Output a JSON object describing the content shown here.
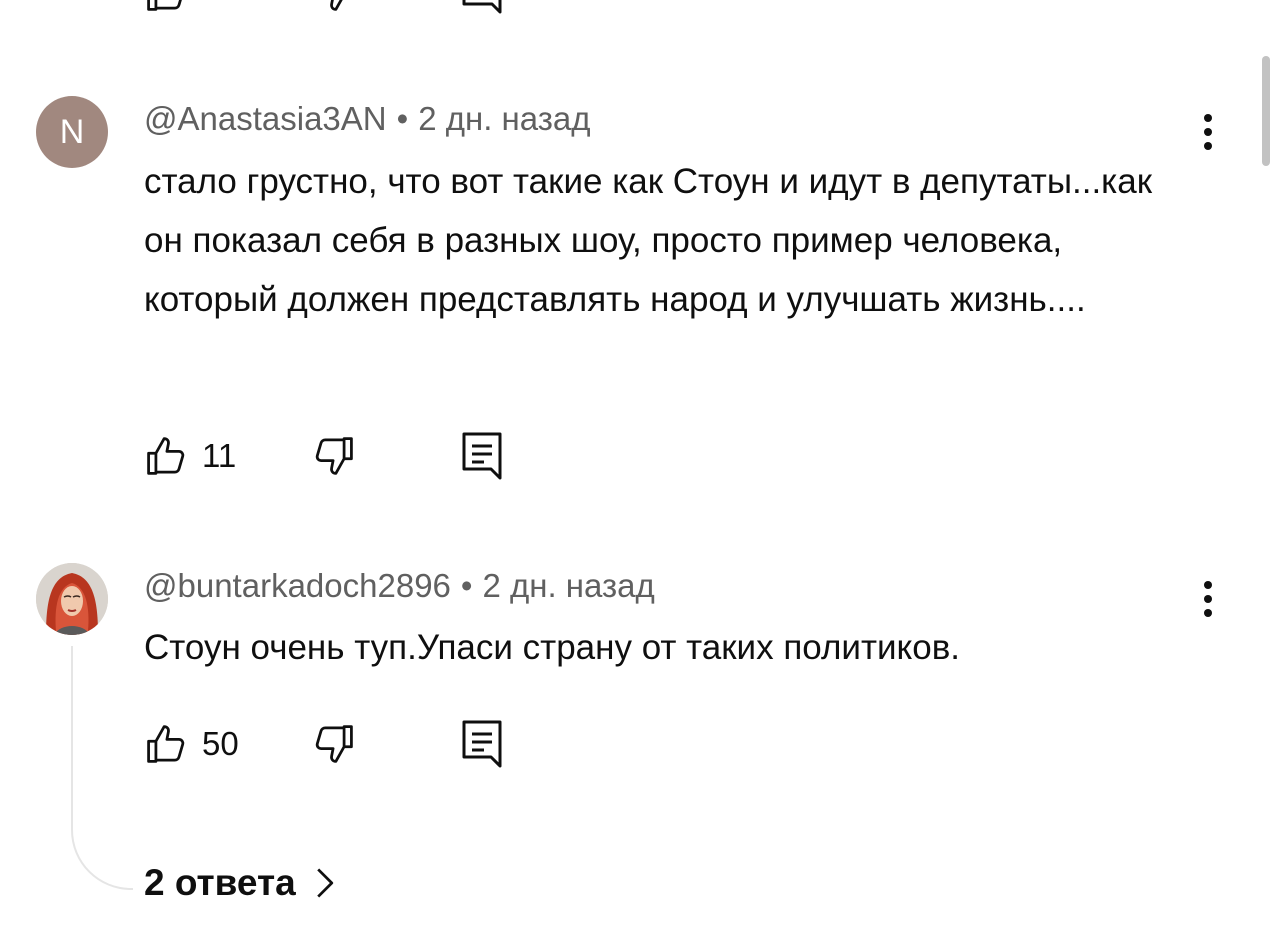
{
  "comments": [
    {
      "avatar_letter": "N",
      "avatar_color": "#a1887f",
      "author": "@Anastasia3AN",
      "separator": "•",
      "time": "2 дн. назад",
      "text": "стало грустно, что вот такие как Стоун и идут в депутаты...как он показал себя в разных шоу, просто пример человека, который должен представлять народ и улучшать жизнь....",
      "likes": "11"
    },
    {
      "author": "@buntarkadoch2896",
      "separator": "•",
      "time": "2 дн. назад",
      "text": "Стоун очень туп.Упаси страну от таких политиков.",
      "likes": "50",
      "replies_label": "2 ответа"
    }
  ],
  "icons": {
    "like": "thumbs-up-icon",
    "dislike": "thumbs-down-icon",
    "reply": "reply-comment-icon",
    "more": "more-vertical-icon",
    "chevron": "chevron-right-icon"
  }
}
